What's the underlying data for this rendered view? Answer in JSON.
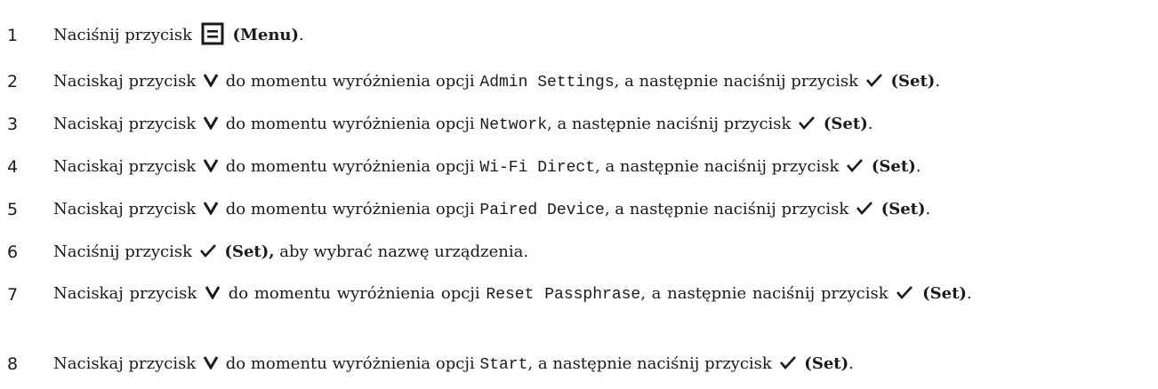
{
  "steps": [
    {
      "number": "1",
      "press": "Naciśnij przycisk",
      "menu_label": "(Menu)",
      "period": "."
    },
    {
      "number": "2",
      "press": "Naciskaj przycisk",
      "until": "do momentu wyróżnienia opcji",
      "option": "Admin Settings",
      "then": ", a następnie naciśnij przycisk",
      "set": "(Set)",
      "period": "."
    },
    {
      "number": "3",
      "press": "Naciskaj przycisk",
      "until": "do momentu wyróżnienia opcji",
      "option": "Network",
      "then": ", a następnie naciśnij przycisk",
      "set": "(Set)",
      "period": "."
    },
    {
      "number": "4",
      "press": "Naciskaj przycisk",
      "until": "do momentu wyróżnienia opcji",
      "option": "Wi-Fi Direct",
      "then": ", a następnie naciśnij przycisk",
      "set": "(Set)",
      "period": "."
    },
    {
      "number": "5",
      "press": "Naciskaj przycisk",
      "until": "do momentu wyróżnienia opcji",
      "option": "Paired Device",
      "then": ", a następnie naciśnij przycisk",
      "set": "(Set)",
      "period": "."
    },
    {
      "number": "6",
      "press": "Naciśnij przycisk",
      "set": "(Set),",
      "rest": "aby wybrać nazwę urządzenia."
    },
    {
      "number": "7",
      "press": "Naciskaj przycisk",
      "until": "do momentu wyróżnienia opcji",
      "option": "Reset Passphrase",
      "then": ", a następnie naciśnij przycisk",
      "set": "(Set)",
      "period": "."
    },
    {
      "number": "8",
      "press": "Naciskaj przycisk",
      "until": "do momentu wyróżnienia opcji",
      "option": "Start",
      "then": ", a następnie naciśnij przycisk",
      "set": "(Set)",
      "period": "."
    }
  ],
  "icons": {
    "menu": "menu-button-icon",
    "down": "down-arrow-icon",
    "check": "checkmark-icon"
  }
}
